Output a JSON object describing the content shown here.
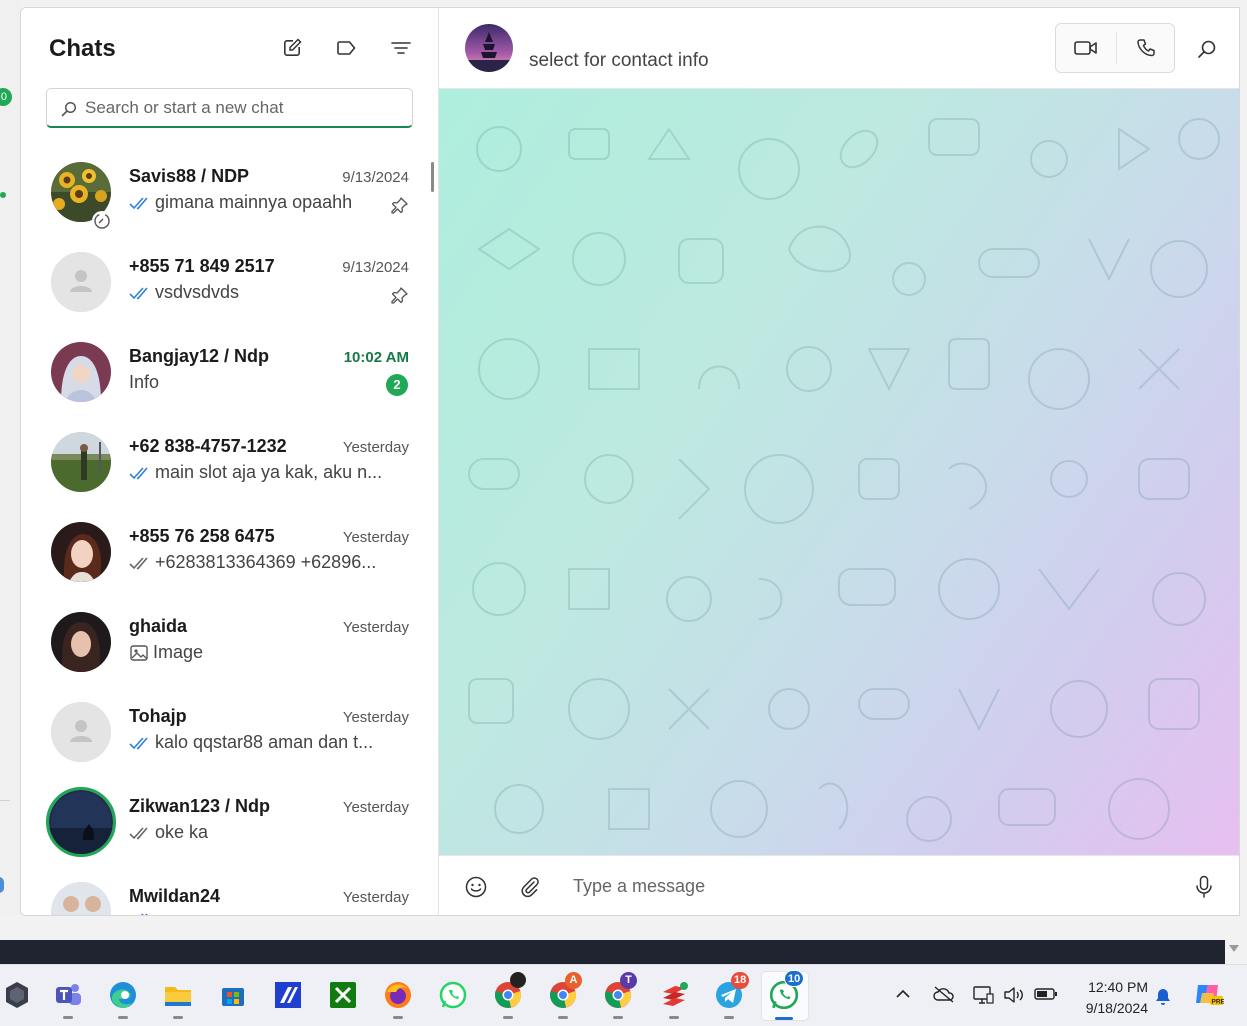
{
  "sidebar": {
    "title": "Chats",
    "search_placeholder": "Search or start a new chat",
    "chats": [
      {
        "name": "Savis88 / NDP",
        "time": "9/13/2024",
        "message": "gimana mainnya opaahh",
        "ticks": "read",
        "pinned": true
      },
      {
        "name": "+855 71 849 2517",
        "time": "9/13/2024",
        "message": "vsdvsdvds",
        "ticks": "read",
        "pinned": true
      },
      {
        "name": "Bangjay12 / Ndp",
        "time": "10:02 AM",
        "message": "Info",
        "unread_count": "2"
      },
      {
        "name": "+62 838-4757-1232",
        "time": "Yesterday",
        "message": "main slot aja ya kak, aku n...",
        "ticks": "read"
      },
      {
        "name": "+855 76 258 6475",
        "time": "Yesterday",
        "message": "+6283813364369 +62896...",
        "ticks": "delivered"
      },
      {
        "name": "ghaida",
        "time": "Yesterday",
        "message": "Image",
        "ticks": "image"
      },
      {
        "name": "Tohajp",
        "time": "Yesterday",
        "message": "kalo qqstar88 aman dan t...",
        "ticks": "read"
      },
      {
        "name": "Zikwan123 / Ndp",
        "time": "Yesterday",
        "message": "oke ka",
        "ticks": "delivered"
      },
      {
        "name": "Mwildan24",
        "time": "Yesterday",
        "message": "",
        "ticks": "read"
      }
    ]
  },
  "conversation": {
    "contact_info": "select for contact info",
    "composer_placeholder": "Type a message"
  },
  "taskbar": {
    "apps": [
      "obs-icon",
      "teams-icon",
      "edge-icon",
      "file-explorer-icon",
      "microsoft-store-icon",
      "app-icon",
      "xbox-icon",
      "firefox-icon",
      "whatsapp-icon",
      "chrome-icon",
      "chrome-profile-a-icon",
      "chrome-profile-t-icon",
      "anydesk-icon",
      "telegram-icon",
      "whatsapp-active-icon"
    ],
    "chrome_badge": "A",
    "chrome_badge_2": "T",
    "telegram_badge": "18",
    "whatsapp_badge": "10",
    "time": "12:40 PM",
    "date": "9/18/2024"
  },
  "colors": {
    "accent": "#1fa855",
    "search_underline": "#168a4e",
    "unread_time": "#157a44"
  }
}
